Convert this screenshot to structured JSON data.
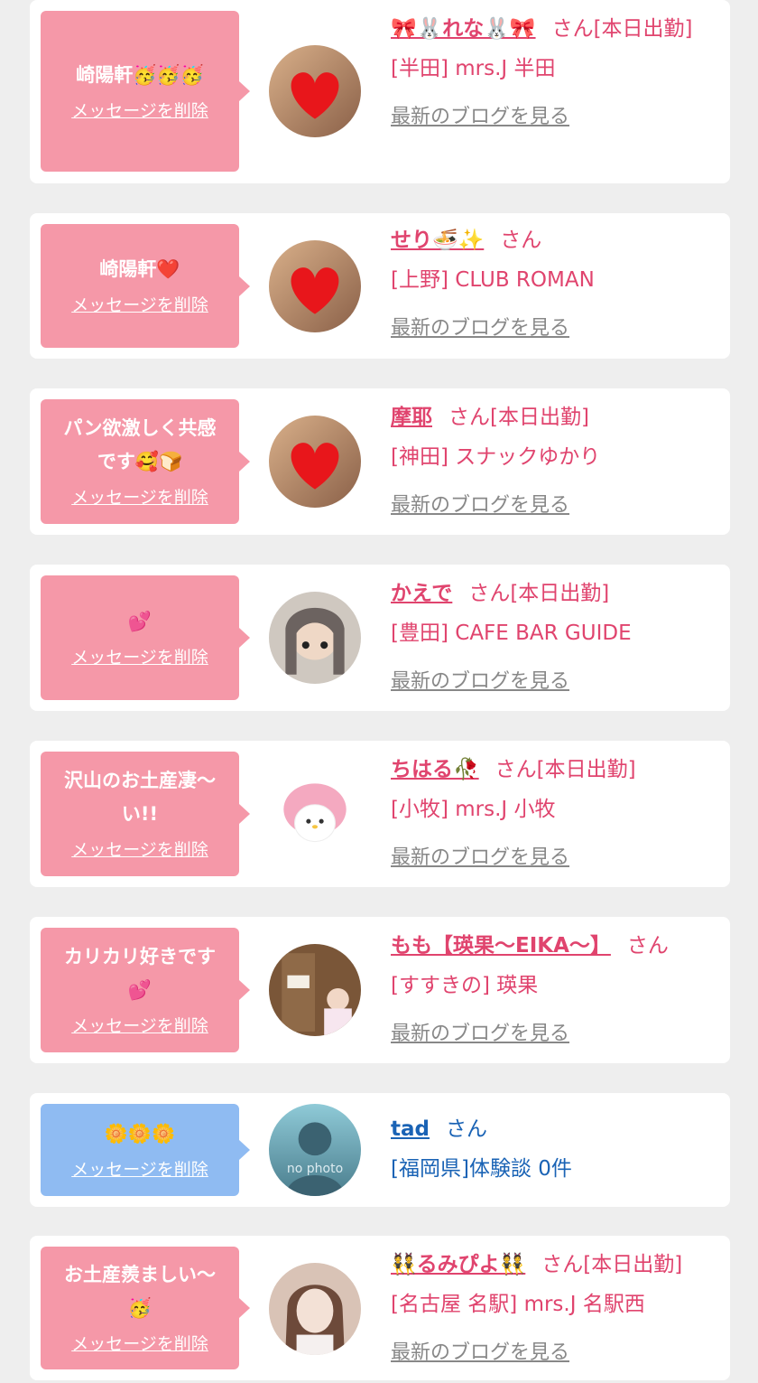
{
  "delete_label": "メッセージを削除",
  "blog_label": "最新のブログを見る",
  "san_label": "さん",
  "colors": {
    "pink_bubble": "#f598a8",
    "blue_bubble": "#8fbbf2",
    "pink_text": "#e0446e",
    "blue_text": "#1a63b5"
  },
  "messages": [
    {
      "message": [
        "崎陽軒🥳🥳🥳"
      ],
      "name": "🎀🐰れな🐰🎀",
      "suffix": "さん[本日出勤]",
      "shop": "[半田] mrs.J 半田",
      "blog": true,
      "theme": "pink",
      "avatar_icon": "heart-sticker-photo"
    },
    {
      "message": [
        "崎陽軒❤️"
      ],
      "name": "せり🍜✨",
      "suffix": "さん",
      "shop": "[上野] CLUB ROMAN",
      "blog": true,
      "theme": "pink",
      "avatar_icon": "heart-sticker-photo"
    },
    {
      "message": [
        "パン欲激しく共感",
        "です🥰🍞"
      ],
      "name": "摩耶",
      "suffix": "さん[本日出勤]",
      "shop": "[神田] スナックゆかり",
      "blog": true,
      "theme": "pink",
      "avatar_icon": "heart-sticker-photo"
    },
    {
      "message": [
        "💕"
      ],
      "name": "かえで",
      "suffix": "さん[本日出勤]",
      "shop": "[豊田] CAFE BAR GUIDE",
      "blog": true,
      "theme": "pink",
      "avatar_icon": "selfie-photo"
    },
    {
      "message": [
        "沢山のお土産凄〜",
        "い!!"
      ],
      "name": "ちはる🥀",
      "suffix": "さん[本日出勤]",
      "shop": "[小牧] mrs.J 小牧",
      "blog": true,
      "theme": "pink",
      "avatar_icon": "plush-toy-photo"
    },
    {
      "message": [
        "カリカリ好きです",
        "💕"
      ],
      "name": "もも【瑛果〜EIKA〜】",
      "suffix": "さん",
      "shop": "[すすきの] 瑛果",
      "blog": true,
      "theme": "pink",
      "avatar_icon": "door-photo"
    },
    {
      "message": [
        "🌼🌼🌼"
      ],
      "name": "tad",
      "suffix": "さん",
      "shop": "[福岡県]体験談 0件",
      "blog": false,
      "theme": "blue",
      "avatar_icon": "no-photo-silhouette",
      "avatar_caption": "no photo"
    },
    {
      "message": [
        "お土産羨ましい〜",
        "🥳"
      ],
      "name": "👯るみぴよ👯",
      "suffix": "さん[本日出勤]",
      "shop": "[名古屋 名駅] mrs.J 名駅西",
      "blog": true,
      "theme": "pink",
      "avatar_icon": "portrait-photo"
    }
  ]
}
